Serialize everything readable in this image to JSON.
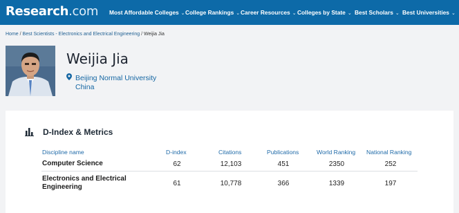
{
  "header": {
    "logo_main": "Research",
    "logo_suffix": ".com",
    "nav": [
      {
        "label": "Most Affordable Colleges"
      },
      {
        "label": "College Rankings"
      },
      {
        "label": "Career Resources"
      },
      {
        "label": "Colleges by State"
      },
      {
        "label": "Best Scholars"
      },
      {
        "label": "Best Universities"
      }
    ],
    "chevron": "⌄"
  },
  "breadcrumb": {
    "items": [
      "Home",
      "Best Scientists - Electronics and Electrical Engineering"
    ],
    "separator": "/",
    "current": "Weijia Jia"
  },
  "profile": {
    "name": "Weijia Jia",
    "university": "Beijing Normal University",
    "country": "China"
  },
  "metrics": {
    "title": "D-Index & Metrics",
    "icon": "bar-chart-icon",
    "columns": [
      "Discipline name",
      "D-index",
      "Citations",
      "Publications",
      "World Ranking",
      "National Ranking"
    ],
    "rows": [
      {
        "discipline": "Computer Science",
        "d_index": "62",
        "citations": "12,103",
        "publications": "451",
        "world_ranking": "2350",
        "national_ranking": "252"
      },
      {
        "discipline": "Electronics and Electrical Engineering",
        "d_index": "61",
        "citations": "10,778",
        "publications": "366",
        "world_ranking": "1339",
        "national_ranking": "197"
      }
    ]
  },
  "colors": {
    "header_bg": "#0d6aa8",
    "link": "#1466a3",
    "page_bg": "#f2f3f5"
  }
}
